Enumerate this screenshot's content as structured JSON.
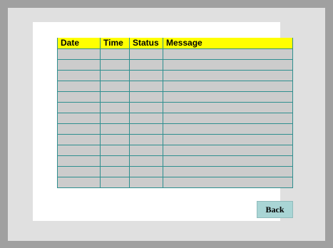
{
  "log_table": {
    "headers": [
      "Date",
      "Time",
      "Status",
      "Message"
    ],
    "rows": [
      [
        "",
        "",
        "",
        ""
      ],
      [
        "",
        "",
        "",
        ""
      ],
      [
        "",
        "",
        "",
        ""
      ],
      [
        "",
        "",
        "",
        ""
      ],
      [
        "",
        "",
        "",
        ""
      ],
      [
        "",
        "",
        "",
        ""
      ],
      [
        "",
        "",
        "",
        ""
      ],
      [
        "",
        "",
        "",
        ""
      ],
      [
        "",
        "",
        "",
        ""
      ],
      [
        "",
        "",
        "",
        ""
      ],
      [
        "",
        "",
        "",
        ""
      ],
      [
        "",
        "",
        "",
        ""
      ],
      [
        "",
        "",
        "",
        ""
      ]
    ]
  },
  "buttons": {
    "back_label": "Back"
  },
  "colors": {
    "header_bg": "#ffff00",
    "grid_line": "#2f8f8f",
    "cell_bg": "#cccccc",
    "back_button_bg": "#a9d5d5"
  }
}
